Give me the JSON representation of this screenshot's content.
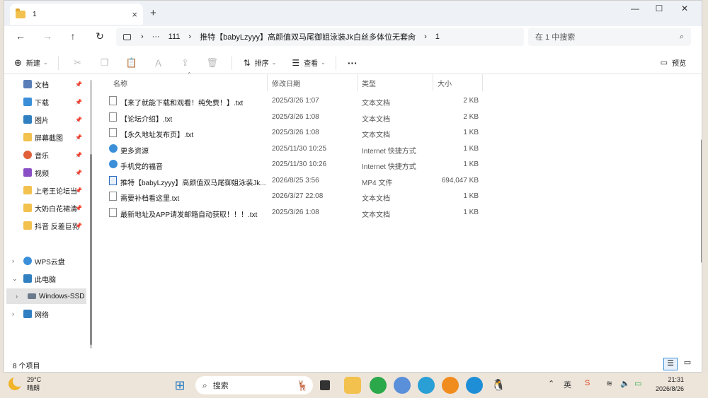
{
  "window": {
    "tab_title": "1",
    "new_tab": "+",
    "controls": {
      "minimize": "—",
      "maximize": "☐",
      "close": "✕"
    }
  },
  "address": {
    "crumbs": [
      "›",
      "···",
      "111",
      "›",
      "推特【babyLzyyy】高颜值双马尾御姐泳装Jk白丝多体位无套肏",
      "›",
      "1"
    ],
    "search_placeholder": "在 1 中搜索"
  },
  "toolbar": {
    "new_label": "新建",
    "sort_label": "排序",
    "view_label": "查看",
    "more_label": "···",
    "preview_label": "预览"
  },
  "nav": {
    "quick": [
      {
        "label": "文档",
        "color": "#5a7fb8"
      },
      {
        "label": "下载",
        "color": "#3b8fd9"
      },
      {
        "label": "图片",
        "color": "#2f7fc1"
      },
      {
        "label": "屏幕截图",
        "color": "#f2c14e"
      },
      {
        "label": "音乐",
        "color": "#e0603a"
      },
      {
        "label": "视频",
        "color": "#8a4fc7"
      },
      {
        "label": "上老王论坛当",
        "color": "#f2c14e"
      },
      {
        "label": "大奶白花裙清",
        "color": "#f2c14e"
      },
      {
        "label": "抖音 反差巨乳",
        "color": "#f2c14e"
      }
    ],
    "tree": [
      {
        "label": "WPS云盘",
        "color": "#3b8fd9",
        "exp": "›"
      },
      {
        "label": "此电脑",
        "color": "#2f7fc1",
        "exp": "⌄"
      },
      {
        "label": "Windows-SSD",
        "color": "#6b7a8c",
        "exp": "›"
      },
      {
        "label": "网络",
        "color": "#2f7fc1",
        "exp": "›"
      }
    ]
  },
  "columns": {
    "name": "名称",
    "date": "修改日期",
    "type": "类型",
    "size": "大小"
  },
  "files": [
    {
      "name": "【来了就能下载和观看！纯免费！】.txt",
      "date": "2025/3/26 1:07",
      "type": "文本文档",
      "size": "2 KB",
      "kind": "txt"
    },
    {
      "name": "【论坛介绍】.txt",
      "date": "2025/3/26 1:08",
      "type": "文本文档",
      "size": "2 KB",
      "kind": "txt"
    },
    {
      "name": "【永久地址发布页】.txt",
      "date": "2025/3/26 1:08",
      "type": "文本文档",
      "size": "1 KB",
      "kind": "txt"
    },
    {
      "name": "更多资源",
      "date": "2025/11/30 10:25",
      "type": "Internet 快捷方式",
      "size": "1 KB",
      "kind": "url"
    },
    {
      "name": "手机党的福音",
      "date": "2025/11/30 10:26",
      "type": "Internet 快捷方式",
      "size": "1 KB",
      "kind": "url"
    },
    {
      "name": "推特【babyLzyyy】高颜值双马尾御姐泳装Jk...",
      "date": "2026/8/25 3:56",
      "type": "MP4 文件",
      "size": "694,047 KB",
      "kind": "mp4"
    },
    {
      "name": "需要补档看这里.txt",
      "date": "2026/3/27 22:08",
      "type": "文本文档",
      "size": "1 KB",
      "kind": "txt"
    },
    {
      "name": "最新地址及APP请发邮箱自动获取！！！.txt",
      "date": "2025/3/26 1:08",
      "type": "文本文档",
      "size": "1 KB",
      "kind": "txt"
    }
  ],
  "status": {
    "count": "8 个项目"
  },
  "taskbar": {
    "temp": "29°C",
    "weather": "晴朗",
    "search_label": "搜索",
    "time": "21:31",
    "date": "2026/8/26"
  }
}
